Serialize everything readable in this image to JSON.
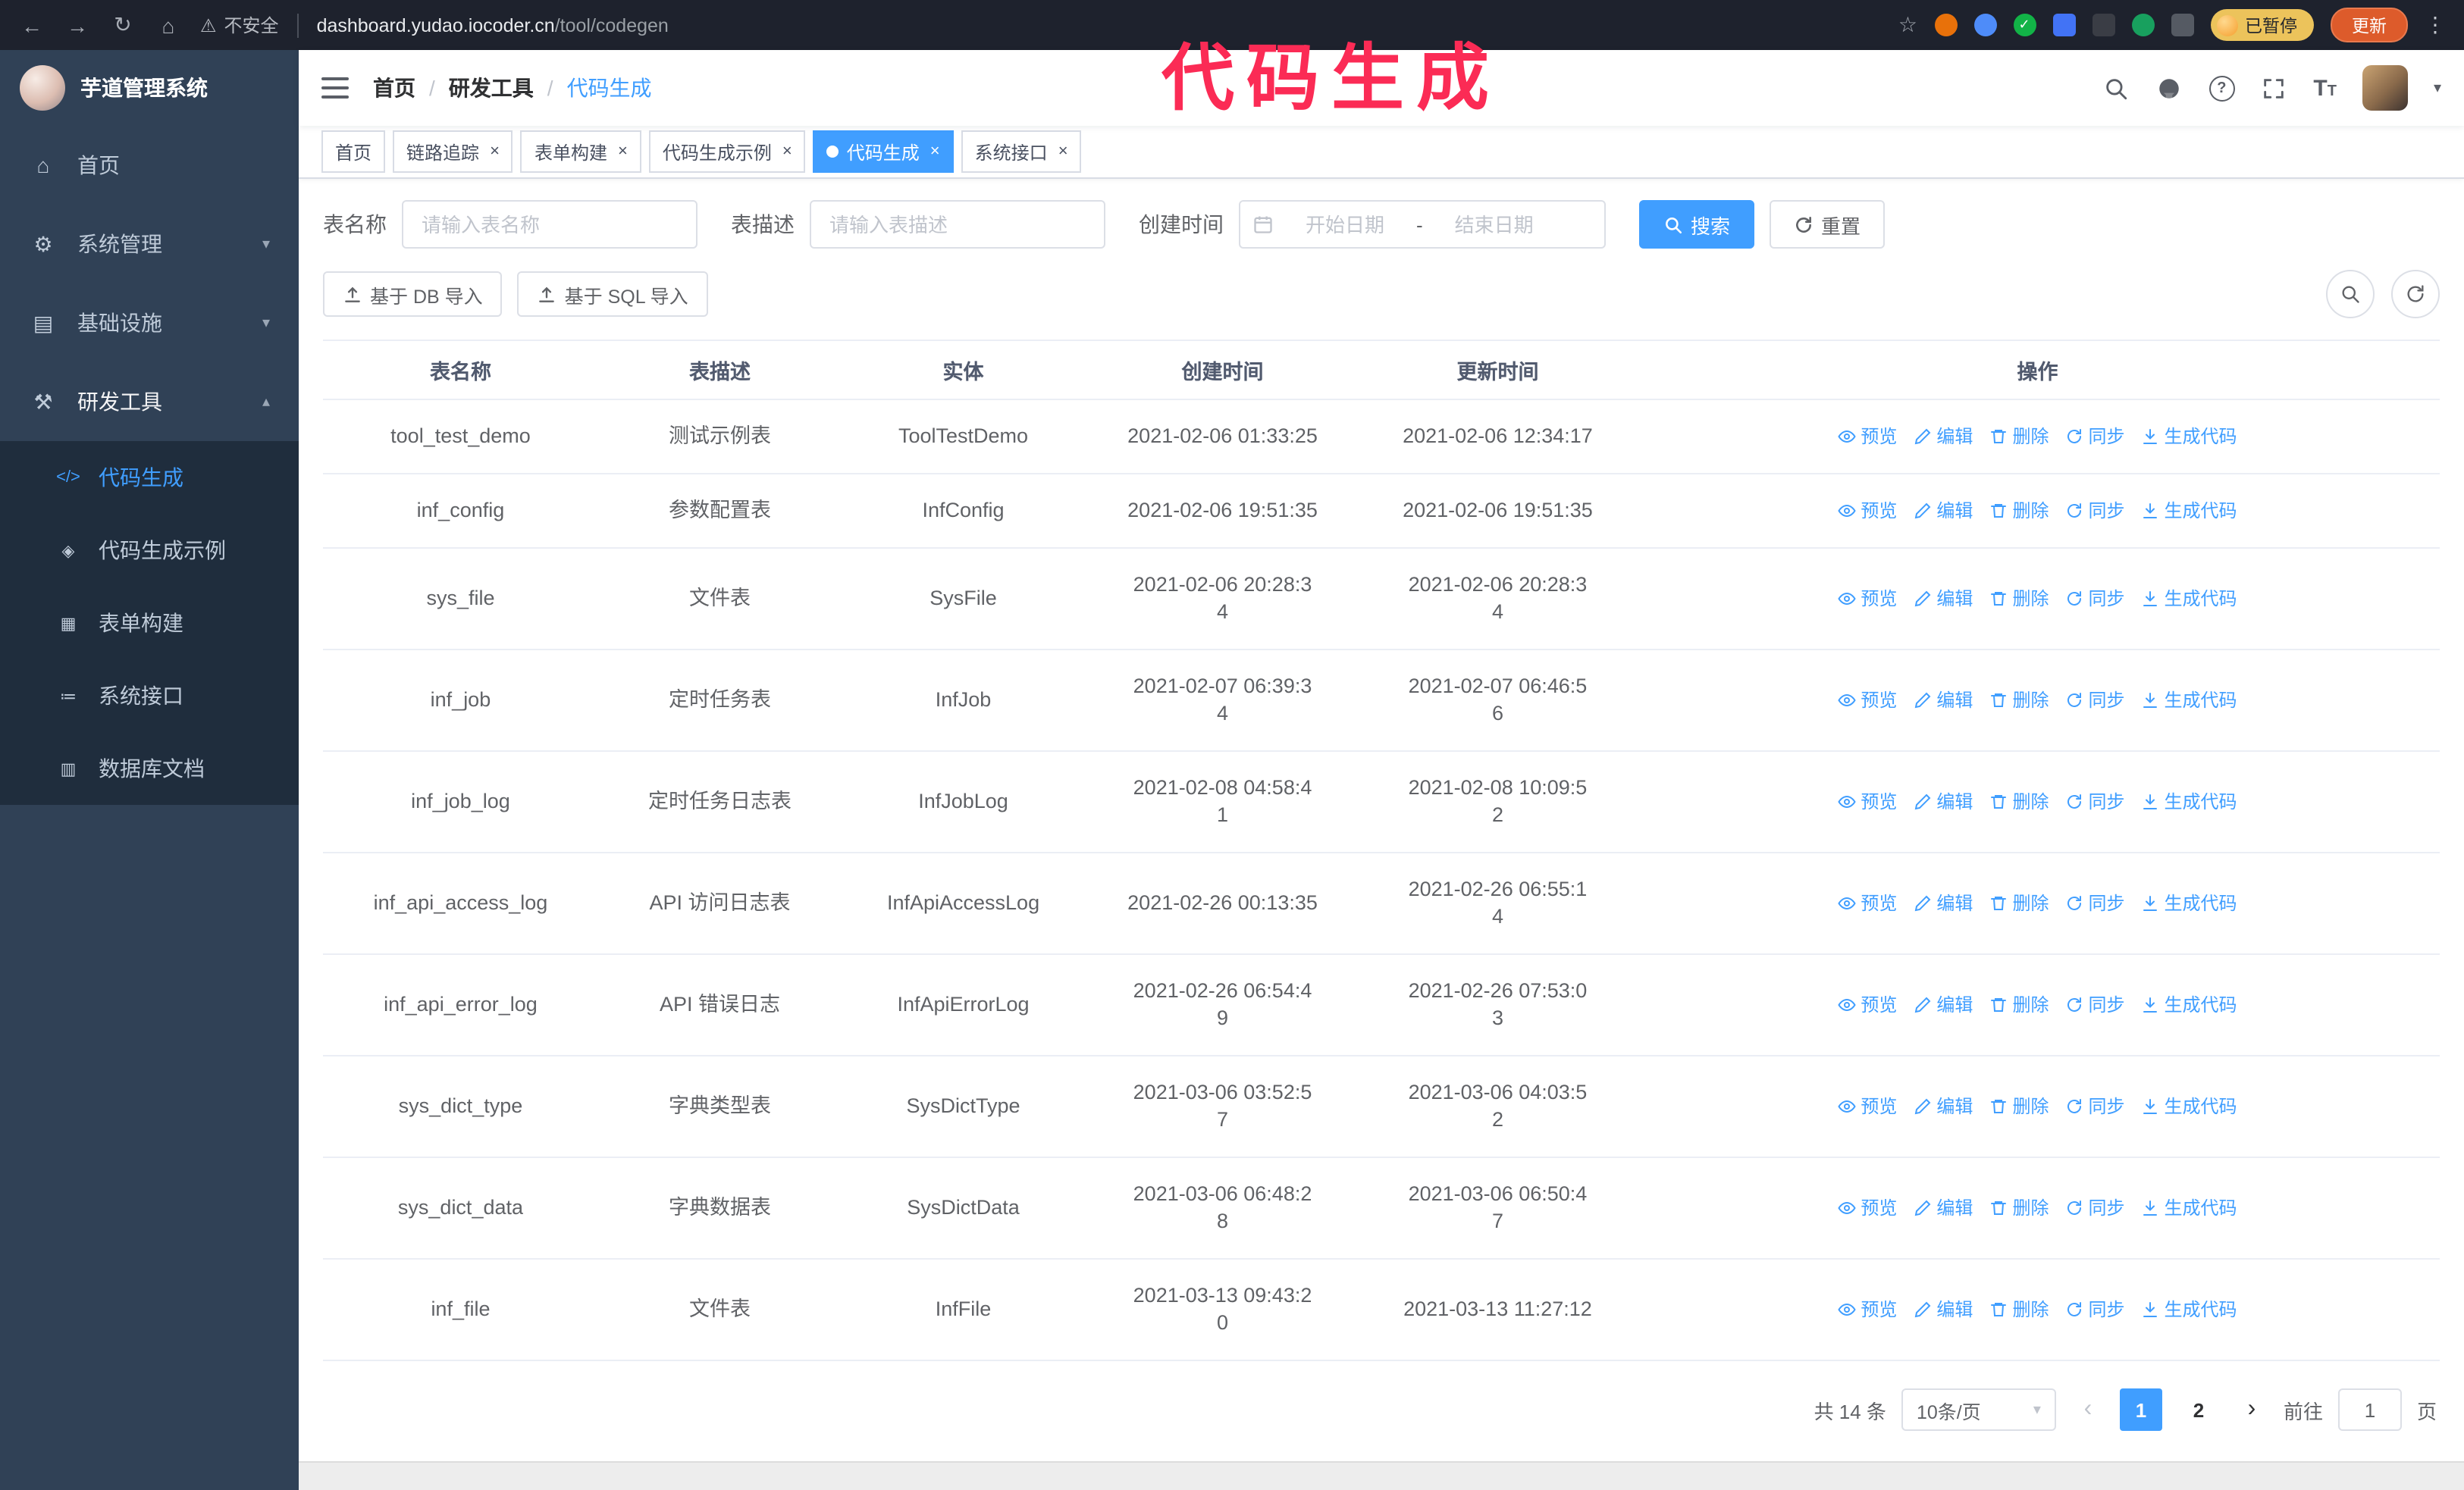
{
  "annotation": {
    "text": "代码生成",
    "color": "#fb2b55"
  },
  "browser": {
    "insecure_label": "不安全",
    "url_domain": "dashboard.yudao.iocoder.cn",
    "url_path": "/tool/codegen",
    "paused_badge": "已暂停",
    "update_button": "更新"
  },
  "sidebar": {
    "logo_title": "芋道管理系统",
    "items": [
      {
        "label": "首页",
        "icon": "⌂"
      },
      {
        "label": "系统管理",
        "icon": "⚙"
      },
      {
        "label": "基础设施",
        "icon": "▤"
      },
      {
        "label": "研发工具",
        "icon": "⚒"
      }
    ],
    "subitems": [
      {
        "label": "代码生成",
        "icon": "</>"
      },
      {
        "label": "代码生成示例",
        "icon": "◈"
      },
      {
        "label": "表单构建",
        "icon": "▦"
      },
      {
        "label": "系统接口",
        "icon": "≔"
      },
      {
        "label": "数据库文档",
        "icon": "▥"
      }
    ]
  },
  "header": {
    "breadcrumb": [
      "首页",
      "研发工具",
      "代码生成"
    ]
  },
  "tabs": [
    {
      "label": "首页"
    },
    {
      "label": "链路追踪"
    },
    {
      "label": "表单构建"
    },
    {
      "label": "代码生成示例"
    },
    {
      "label": "代码生成"
    },
    {
      "label": "系统接口"
    }
  ],
  "filters": {
    "name_label": "表名称",
    "name_placeholder": "请输入表名称",
    "desc_label": "表描述",
    "desc_placeholder": "请输入表描述",
    "time_label": "创建时间",
    "start_placeholder": "开始日期",
    "range_separator": "-",
    "end_placeholder": "结束日期",
    "search_button": "搜索",
    "reset_button": "重置"
  },
  "toolbar": {
    "import_db": "基于 DB 导入",
    "import_sql": "基于 SQL 导入"
  },
  "table": {
    "columns": [
      "表名称",
      "表描述",
      "实体",
      "创建时间",
      "更新时间",
      "操作"
    ],
    "actions": [
      {
        "label": "预览",
        "icon": "eye"
      },
      {
        "label": "编辑",
        "icon": "edit"
      },
      {
        "label": "删除",
        "icon": "delete"
      },
      {
        "label": "同步",
        "icon": "sync"
      },
      {
        "label": "生成代码",
        "icon": "download"
      }
    ],
    "rows": [
      {
        "name": "tool_test_demo",
        "desc": "测试示例表",
        "entity": "ToolTestDemo",
        "created": "2021-02-06 01:33:25",
        "updated": "2021-02-06 12:34:17"
      },
      {
        "name": "inf_config",
        "desc": "参数配置表",
        "entity": "InfConfig",
        "created": "2021-02-06 19:51:35",
        "updated": "2021-02-06 19:51:35"
      },
      {
        "name": "sys_file",
        "desc": "文件表",
        "entity": "SysFile",
        "created": "2021-02-06 20:28:3\n4",
        "updated": "2021-02-06 20:28:3\n4"
      },
      {
        "name": "inf_job",
        "desc": "定时任务表",
        "entity": "InfJob",
        "created": "2021-02-07 06:39:3\n4",
        "updated": "2021-02-07 06:46:5\n6"
      },
      {
        "name": "inf_job_log",
        "desc": "定时任务日志表",
        "entity": "InfJobLog",
        "created": "2021-02-08 04:58:4\n1",
        "updated": "2021-02-08 10:09:5\n2"
      },
      {
        "name": "inf_api_access_log",
        "desc": "API 访问日志表",
        "entity": "InfApiAccessLog",
        "created": "2021-02-26 00:13:35",
        "updated": "2021-02-26 06:55:1\n4"
      },
      {
        "name": "inf_api_error_log",
        "desc": "API 错误日志",
        "entity": "InfApiErrorLog",
        "created": "2021-02-26 06:54:4\n9",
        "updated": "2021-02-26 07:53:0\n3"
      },
      {
        "name": "sys_dict_type",
        "desc": "字典类型表",
        "entity": "SysDictType",
        "created": "2021-03-06 03:52:5\n7",
        "updated": "2021-03-06 04:03:5\n2"
      },
      {
        "name": "sys_dict_data",
        "desc": "字典数据表",
        "entity": "SysDictData",
        "created": "2021-03-06 06:48:2\n8",
        "updated": "2021-03-06 06:50:4\n7"
      },
      {
        "name": "inf_file",
        "desc": "文件表",
        "entity": "InfFile",
        "created": "2021-03-13 09:43:2\n0",
        "updated": "2021-03-13 11:27:12"
      }
    ]
  },
  "pagination": {
    "total": "共 14 条",
    "page_size": "10条/页",
    "pages": [
      "1",
      "2"
    ],
    "active_page": "1",
    "goto_label": "前往",
    "goto_value": "1",
    "goto_suffix": "页"
  },
  "colors": {
    "accent": "#409eff",
    "sidebar_bg": "#304156",
    "submenu_bg": "#1f2d3d",
    "annotation": "#fb2b55"
  }
}
